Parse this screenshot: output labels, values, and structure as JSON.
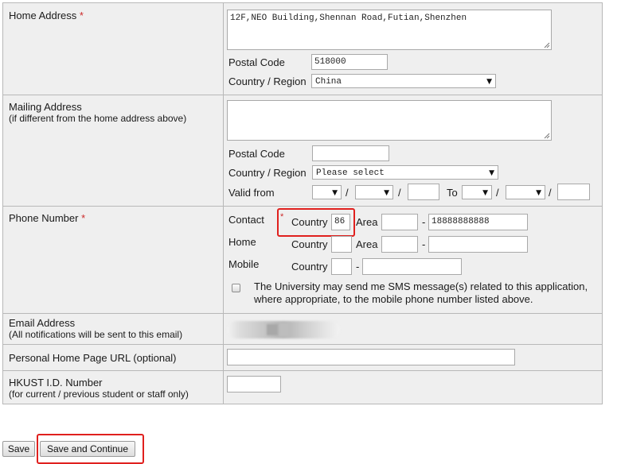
{
  "home": {
    "label": "Home Address",
    "required_mark": "*",
    "address_value": "12F,NEO Building,Shennan Road,Futian,Shenzhen",
    "postal_label": "Postal Code",
    "postal_value": "518000",
    "country_label": "Country / Region",
    "country_value": "China"
  },
  "mailing": {
    "label": "Mailing Address",
    "sublabel": "(if different from the home address above)",
    "address_value": "",
    "postal_label": "Postal Code",
    "postal_value": "",
    "country_label": "Country / Region",
    "country_value": "Please select",
    "valid_from_label": "Valid from",
    "to_label": "To",
    "sep": "/"
  },
  "phone": {
    "label": "Phone Number",
    "required_mark": "*",
    "contact_label": "Contact",
    "home_label": "Home",
    "mobile_label": "Mobile",
    "country_label": "Country",
    "area_label": "Area",
    "dash": "-",
    "contact_country_value": "86",
    "contact_area_value": "",
    "contact_number_value": "18888888888",
    "sms_text_line1": "The University may send me SMS message(s) related to this application,",
    "sms_text_line2": "where appropriate, to the mobile phone number listed above."
  },
  "email": {
    "label": "Email Address",
    "sublabel": "(All notifications will be sent to this email)"
  },
  "homepage": {
    "label": "Personal Home Page URL (optional)",
    "value": ""
  },
  "hkust": {
    "label": "HKUST I.D. Number",
    "sublabel": "(for current / previous student or staff only)",
    "value": ""
  },
  "buttons": {
    "save_label": "Save",
    "save_continue_label": "Save and Continue"
  },
  "colors": {
    "highlight": "#e0201e",
    "required": "#cc2a2a",
    "panel_bg": "#efefef"
  }
}
